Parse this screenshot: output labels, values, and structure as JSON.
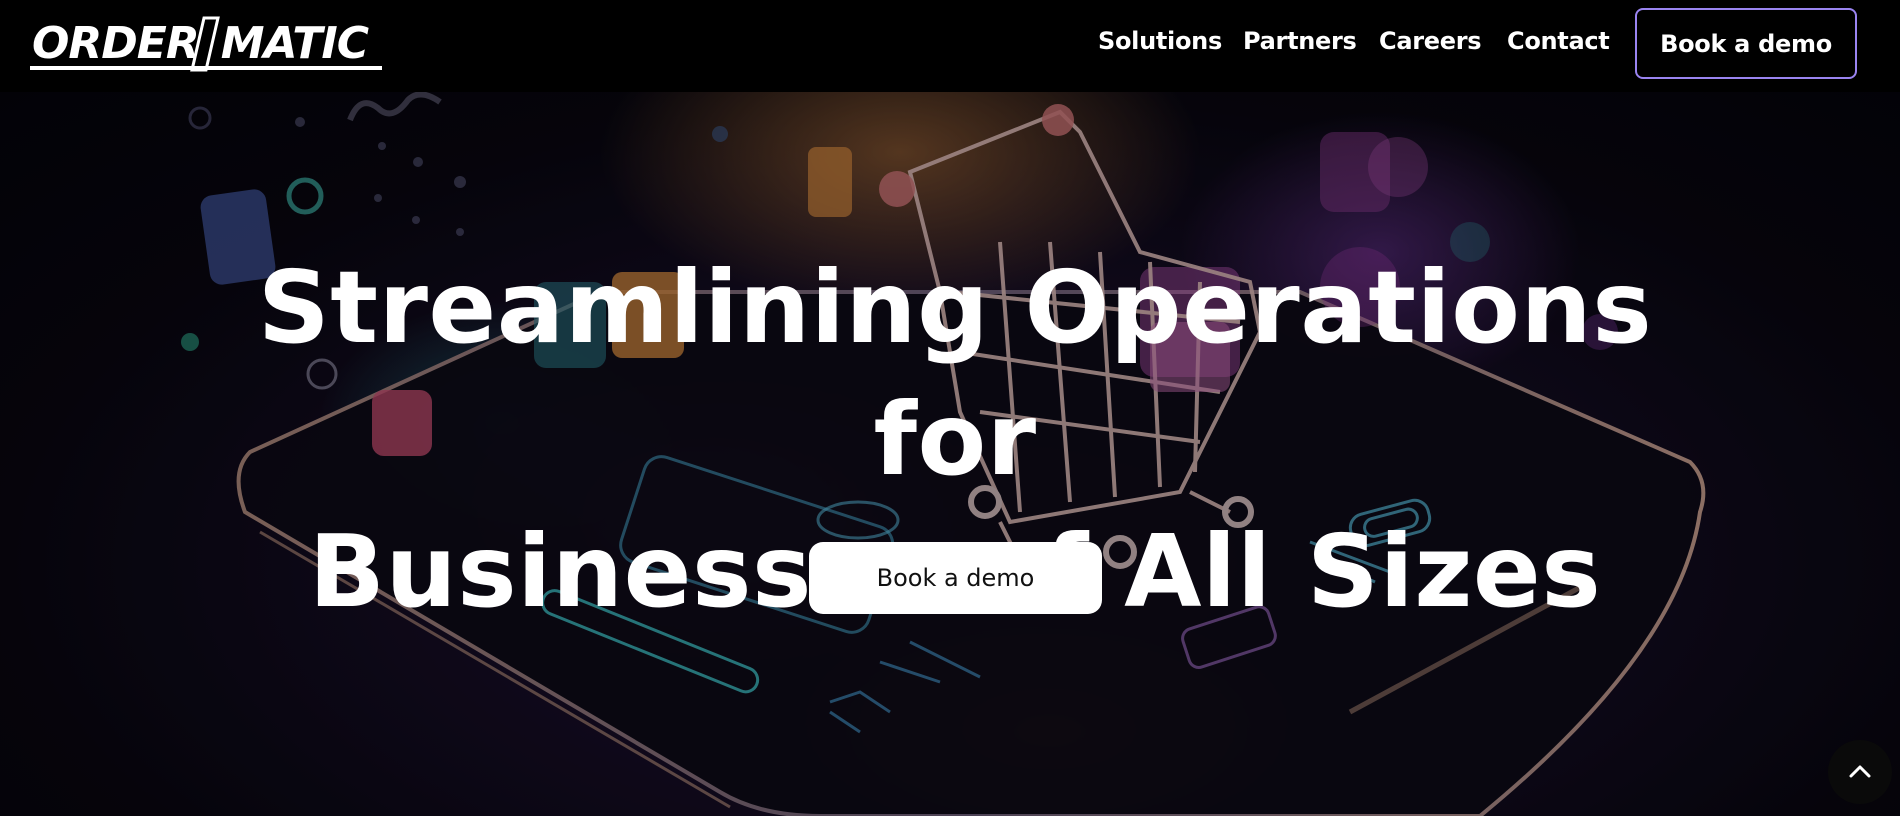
{
  "brand": {
    "logo_text_left": "ORDER",
    "logo_text_right": "MATIC"
  },
  "nav": {
    "links": [
      {
        "label": "Solutions"
      },
      {
        "label": "Partners"
      },
      {
        "label": "Careers"
      },
      {
        "label": "Contact"
      }
    ],
    "cta_label": "Book a demo",
    "cta_border_color": "#9a84f0"
  },
  "hero": {
    "headline_line1": "Streamlining Operations for",
    "headline_line2": "Businesses of All Sizes",
    "cta_label": "Book a demo",
    "background_image": "smartphone-with-neon-shopping-cart-illustration"
  },
  "scroll_top": {
    "icon": "chevron-up-icon"
  }
}
